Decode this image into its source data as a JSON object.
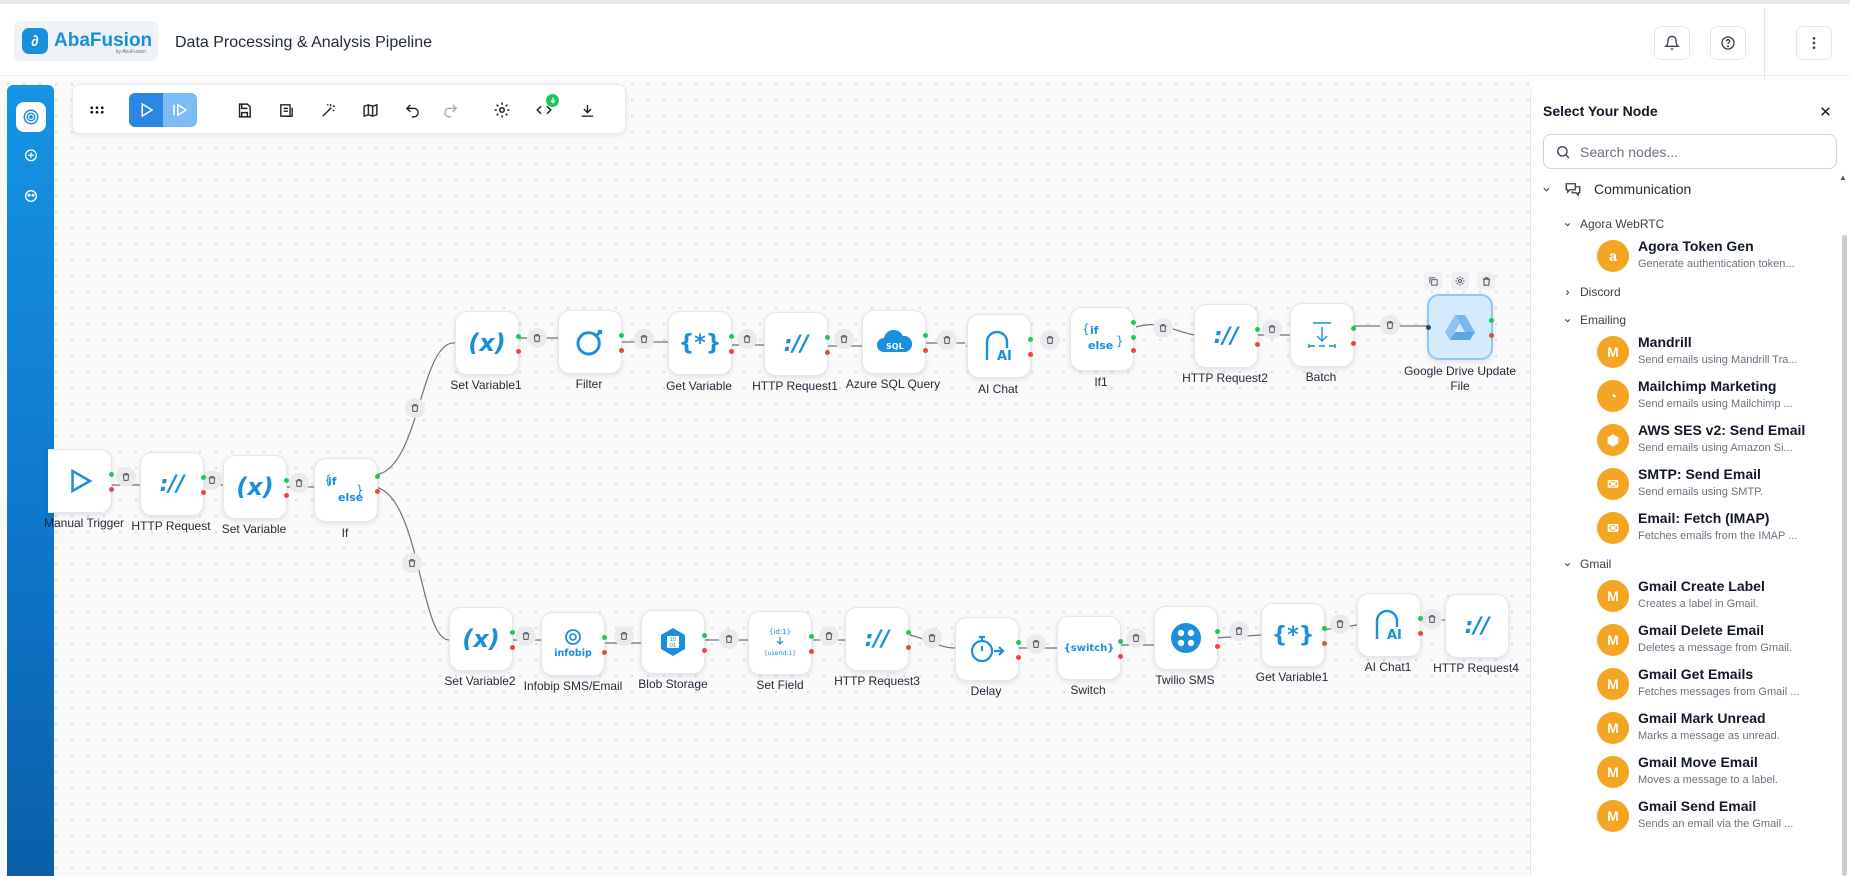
{
  "header": {
    "brand": "AbaFusion",
    "brand_sub": "by AbaFusion",
    "title": "Data Processing & Analysis Pipeline",
    "icons": [
      "bell-icon",
      "help-icon",
      "more-vertical-icon"
    ]
  },
  "rail": {
    "icons": [
      "workflow-icon",
      "chat-icon",
      "agent-icon"
    ]
  },
  "toolbar": {
    "icons": [
      "apps-grid-icon",
      "run-icon",
      "run-step-icon",
      "save-icon",
      "import-icon",
      "magic-icon",
      "map-icon",
      "undo-icon",
      "redo-icon",
      "settings-icon",
      "code-icon",
      "download-icon"
    ]
  },
  "nodes": {
    "manual_trigger": "Manual Trigger",
    "http_request": "HTTP Request",
    "set_variable": "Set Variable",
    "if": "If",
    "set_variable1": "Set Variable1",
    "filter": "Filter",
    "get_variable": "Get Variable",
    "http_request1": "HTTP Request1",
    "azure_sql": "Azure SQL Query",
    "ai_chat": "AI Chat",
    "if1": "If1",
    "http_request2": "HTTP Request2",
    "batch": "Batch",
    "gdrive": "Google Drive Update File",
    "set_variable2": "Set Variable2",
    "infobip": "Infobip SMS/Email",
    "blob": "Blob Storage",
    "set_field": "Set Field",
    "http_request3": "HTTP Request3",
    "delay": "Delay",
    "switch": "Switch",
    "twilio": "Twilio SMS",
    "get_variable1": "Get Variable1",
    "ai_chat1": "AI Chat1",
    "http_request4": "HTTP Request4"
  },
  "node_glyphs": {
    "sql": "SQL",
    "infobip": "infobip",
    "switch": "{switch}",
    "ai": "AI",
    "if": "if",
    "else": "else"
  },
  "panel": {
    "title": "Select Your Node",
    "search_placeholder": "Search nodes...",
    "category": "Communication",
    "groups": {
      "agora": "Agora WebRTC",
      "discord": "Discord",
      "emailing": "Emailing",
      "gmail": "Gmail"
    },
    "items": [
      {
        "name": "Agora Token Gen",
        "desc": "Generate authentication token..."
      },
      {
        "name": "Mandrill",
        "desc": "Send emails using Mandrill Tra..."
      },
      {
        "name": "Mailchimp Marketing",
        "desc": "Send emails using Mailchimp ..."
      },
      {
        "name": "AWS SES v2: Send Email",
        "desc": "Send emails using Amazon Si..."
      },
      {
        "name": "SMTP: Send Email",
        "desc": "Send emails using SMTP."
      },
      {
        "name": "Email: Fetch (IMAP)",
        "desc": "Fetches emails from the IMAP ..."
      },
      {
        "name": "Gmail Create Label",
        "desc": "Creates a label in Gmail."
      },
      {
        "name": "Gmail Delete Email",
        "desc": "Deletes a message from Gmail."
      },
      {
        "name": "Gmail Get Emails",
        "desc": "Fetches messages from Gmail ..."
      },
      {
        "name": "Gmail Mark Unread",
        "desc": "Marks a message as unread."
      },
      {
        "name": "Gmail Move Email",
        "desc": "Moves a message to a label."
      },
      {
        "name": "Gmail Send Email",
        "desc": "Sends an email via the Gmail ..."
      }
    ]
  },
  "colors": {
    "accent": "#1a8fdc",
    "node_icon_bg": "#f5a524",
    "port_success": "#22c55e",
    "port_error": "#ef4444"
  }
}
